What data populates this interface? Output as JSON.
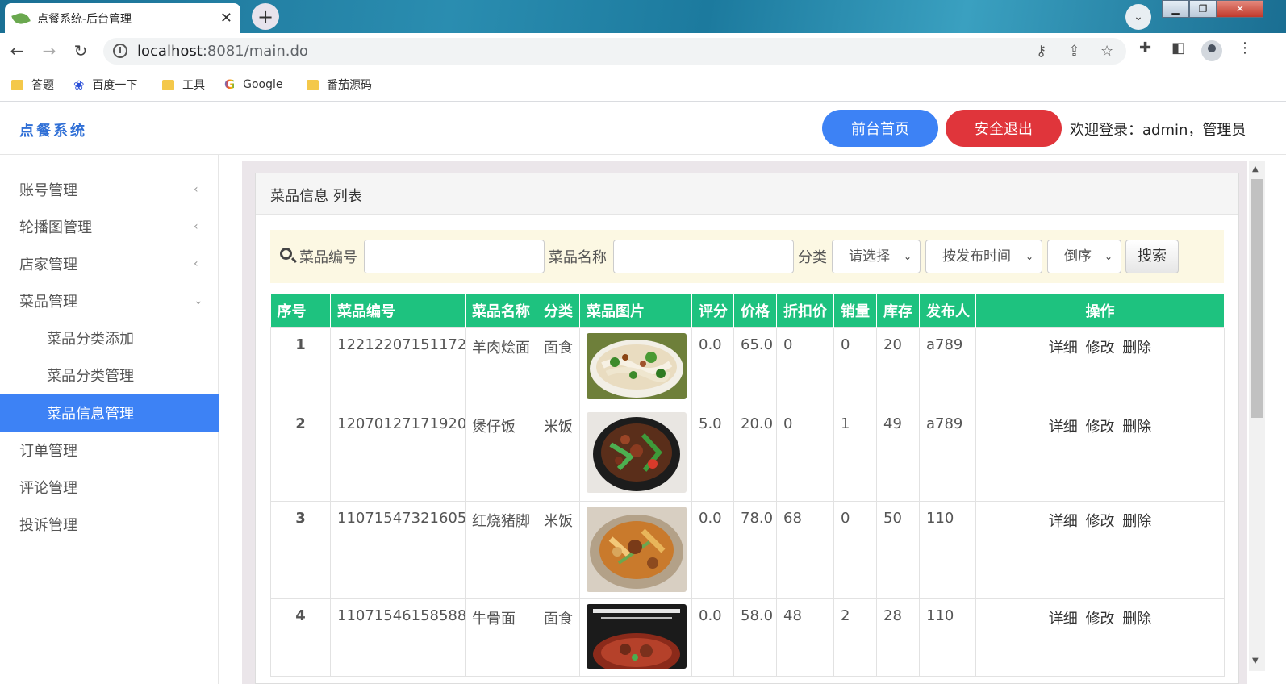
{
  "browser": {
    "tab_title": "点餐系统-后台管理",
    "tab_close": "✕",
    "new_tab": "+",
    "url_host": "localhost",
    "url_rest": ":8081/main.do",
    "bookmarks": [
      {
        "label": "答题",
        "icon": "folder-icon"
      },
      {
        "label": "百度一下",
        "icon": "baidu-paw-icon"
      },
      {
        "label": "工具",
        "icon": "folder-icon"
      },
      {
        "label": "Google",
        "icon": "google-icon"
      },
      {
        "label": "番茄源码",
        "icon": "folder-icon"
      }
    ]
  },
  "header": {
    "brand": "点餐系统",
    "home_button": "前台首页",
    "logout_button": "安全退出",
    "welcome": "欢迎登录：admin，管理员"
  },
  "sidebar": {
    "items": [
      {
        "label": "账号管理",
        "chevron": "‹"
      },
      {
        "label": "轮播图管理",
        "chevron": "‹"
      },
      {
        "label": "店家管理",
        "chevron": "‹"
      },
      {
        "label": "菜品管理",
        "chevron": "⌄"
      },
      {
        "label": "菜品分类添加"
      },
      {
        "label": "菜品分类管理"
      },
      {
        "label": "菜品信息管理"
      },
      {
        "label": "订单管理"
      },
      {
        "label": "评论管理"
      },
      {
        "label": "投诉管理"
      }
    ],
    "active_index": 6
  },
  "panel": {
    "title": "菜品信息 列表"
  },
  "search": {
    "code_label": "菜品编号",
    "code_value": "",
    "name_label": "菜品名称",
    "name_value": "",
    "category_label": "分类",
    "category_selected": "请选择",
    "sort_field_selected": "按发布时间",
    "sort_order_selected": "倒序",
    "search_button": "搜索"
  },
  "table": {
    "headers": [
      "序号",
      "菜品编号",
      "菜品名称",
      "分类",
      "菜品图片",
      "评分",
      "价格",
      "折扣价",
      "销量",
      "库存",
      "发布人",
      "操作"
    ],
    "actions": [
      "详细",
      "修改",
      "删除"
    ],
    "rows": [
      {
        "no": "1",
        "code": "12212207151172",
        "name": "羊肉烩面",
        "category": "面食",
        "image": "mutton-noodle-soup",
        "rating": "0.0",
        "price": "65.0",
        "discount": "0",
        "sales": "0",
        "stock": "20",
        "publisher": "a789"
      },
      {
        "no": "2",
        "code": "12070127171920",
        "name": "煲仔饭",
        "category": "米饭",
        "image": "claypot-rice",
        "rating": "5.0",
        "price": "20.0",
        "discount": "0",
        "sales": "1",
        "stock": "49",
        "publisher": "a789"
      },
      {
        "no": "3",
        "code": "11071547321605",
        "name": "红烧猪脚",
        "category": "米饭",
        "image": "braised-pork-trotter",
        "rating": "0.0",
        "price": "78.0",
        "discount": "68",
        "sales": "0",
        "stock": "50",
        "publisher": "110"
      },
      {
        "no": "4",
        "code": "11071546158588",
        "name": "牛骨面",
        "category": "面食",
        "image": "beef-bone-noodle",
        "rating": "0.0",
        "price": "58.0",
        "discount": "48",
        "sales": "2",
        "stock": "28",
        "publisher": "110"
      }
    ]
  }
}
